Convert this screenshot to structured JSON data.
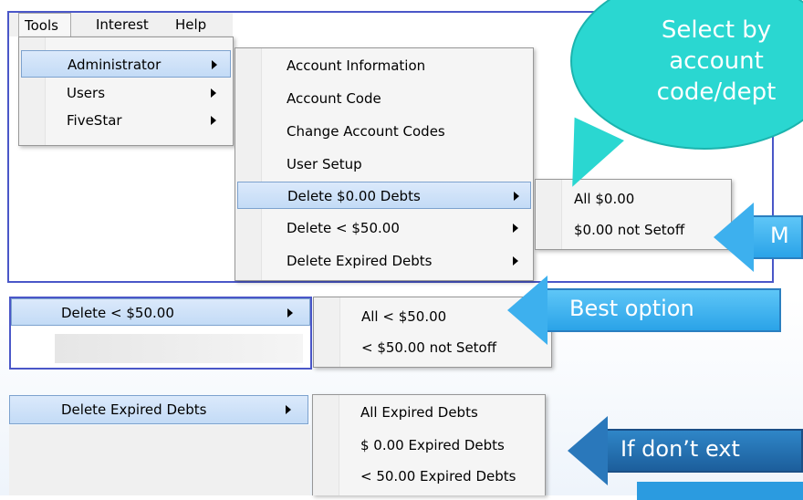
{
  "menubar": {
    "tools": "Tools",
    "interest": "Interest",
    "help": "Help"
  },
  "tools_menu": [
    "Administrator",
    "Users",
    "FiveStar"
  ],
  "admin_menu": [
    "Account Information",
    "Account Code",
    "Change Account Codes",
    "User Setup",
    "Delete $0.00 Debts",
    "Delete < $50.00",
    "Delete Expired Debts"
  ],
  "zero_submenu": [
    "All $0.00",
    "$0.00 not Setoff"
  ],
  "callout": {
    "line1": "Select by",
    "line2": "account",
    "line3": "code/dept"
  },
  "arrow_labels": {
    "top": "M",
    "middle": "Best option",
    "bottom": "If don’t ext"
  },
  "lt50": {
    "parent": "Delete < $50.00",
    "items": [
      "All <  $50.00",
      "< $50.00 not Setoff"
    ]
  },
  "expired": {
    "parent": "Delete Expired Debts",
    "items": [
      "All Expired Debts",
      "$ 0.00 Expired Debts",
      "< 50.00 Expired Debts"
    ]
  },
  "colors": {
    "callout": "#2ad7d1",
    "arrow": "#3db0ee",
    "border": "#4a57c8"
  }
}
